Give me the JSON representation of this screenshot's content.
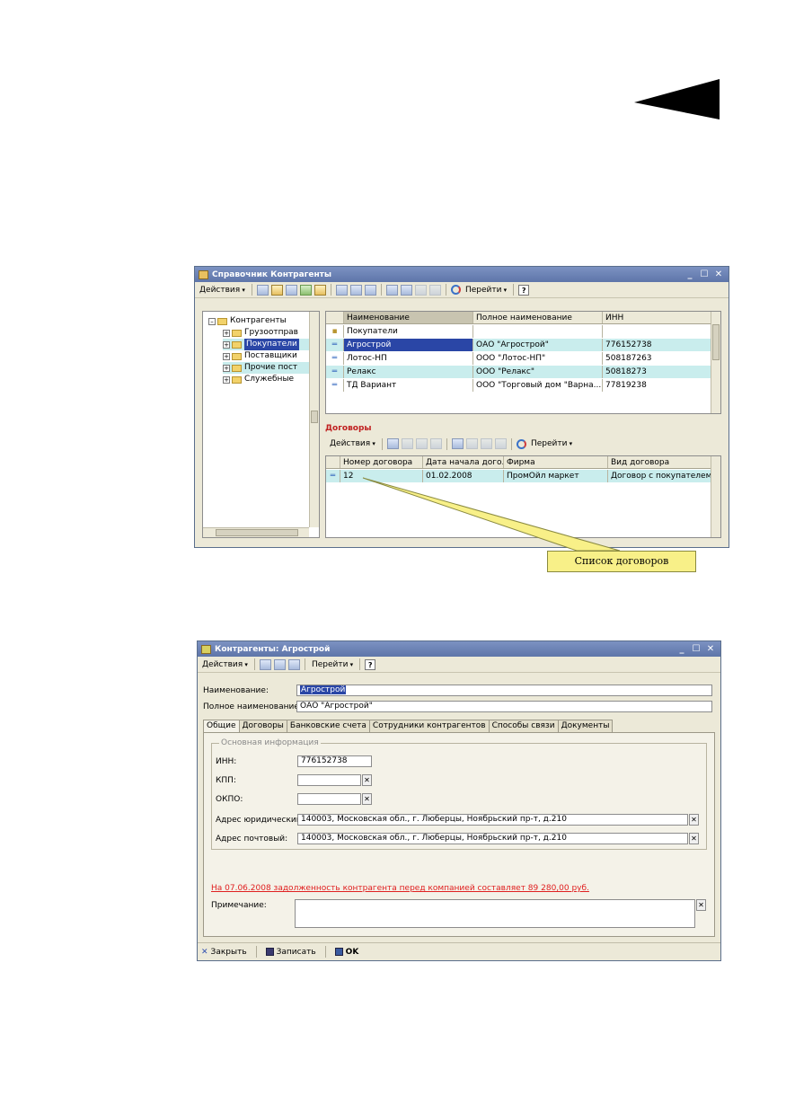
{
  "window1": {
    "title": "Справочник Контрагенты",
    "toolbar": {
      "actions": "Действия",
      "goto": "Перейти",
      "help": "?"
    },
    "tree": [
      {
        "label": "Контрагенты",
        "level": 0,
        "exp": "–"
      },
      {
        "label": "Грузоотправ",
        "level": 1,
        "exp": "+"
      },
      {
        "label": "Покупатели",
        "level": 1,
        "exp": "+",
        "selected": true
      },
      {
        "label": "Поставщики",
        "level": 1,
        "exp": "+"
      },
      {
        "label": "Прочие пост",
        "level": 1,
        "exp": "+"
      },
      {
        "label": "Служебные",
        "level": 1,
        "exp": "+"
      }
    ],
    "table": {
      "columns": [
        "Наименование",
        "Полное наименование",
        "ИНН"
      ],
      "group_row": "Покупатели",
      "rows": [
        {
          "name": "Агрострой",
          "full": "ОАО \"Агрострой\"",
          "inn": "776152738"
        },
        {
          "name": "Лотос-НП",
          "full": "ООО \"Лотос-НП\"",
          "inn": "508187263"
        },
        {
          "name": "Релакс",
          "full": "ООО \"Релакс\"",
          "inn": "50818273"
        },
        {
          "name": "ТД Вариант",
          "full": "ООО \"Торговый дом \"Варна...",
          "inn": "77819238"
        }
      ]
    },
    "contracts": {
      "title": "Договоры",
      "toolbar": {
        "actions": "Действия",
        "goto": "Перейти"
      },
      "columns": [
        "Номер договора",
        "Дата начала дого...",
        "Фирма",
        "Вид договора"
      ],
      "rows": [
        {
          "num": "12",
          "date": "01.02.2008",
          "firm": "ПромОйл маркет",
          "kind": "Договор с покупателем"
        }
      ]
    }
  },
  "callout": {
    "text": "Список договоров"
  },
  "window2": {
    "title": "Контрагенты: Агрострой",
    "toolbar": {
      "actions": "Действия",
      "goto": "Перейти",
      "help": "?"
    },
    "name_label": "Наименование:",
    "name_value": "Агрострой",
    "fullname_label": "Полное наименование:",
    "fullname_value": "ОАО \"Агрострой\"",
    "tabs": [
      "Общие",
      "Договоры",
      "Банковские счета",
      "Сотрудники контрагентов",
      "Способы связи",
      "Документы"
    ],
    "group_title": "Основная информация",
    "inn_label": "ИНН:",
    "inn_value": "776152738",
    "kpp_label": "КПП:",
    "okpo_label": "ОКПО:",
    "addr_legal_label": "Адрес юридический:",
    "addr_legal_value": "140003, Московская обл., г. Люберцы, Ноябрьский пр-т, д.210",
    "addr_post_label": "Адрес почтовый:",
    "addr_post_value": "140003, Московская обл., г. Люберцы, Ноябрьский пр-т, д.210",
    "debt_warning": "На 07.06.2008 задолженность контрагента перед компанией составляет 89 280,00 руб.",
    "notes_label": "Примечание:",
    "bottom": {
      "close": "Закрыть",
      "save": "Записать",
      "ok": "OK"
    }
  }
}
